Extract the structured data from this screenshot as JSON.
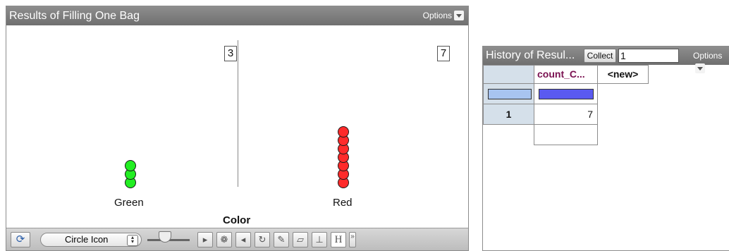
{
  "graph": {
    "title": "Results of Filling One Bag",
    "options_label": "Options",
    "axis_label": "Color",
    "categories": [
      {
        "name": "Green",
        "count": "3",
        "dot_color": "#22ee22"
      },
      {
        "name": "Red",
        "count": "7",
        "dot_color": "#ff2a2a"
      }
    ],
    "toolbar": {
      "select_value": "Circle Icon",
      "icons": [
        "rescale-icon",
        "point-size-slider-icon",
        "select-arrow-icon",
        "hide-show-icon",
        "move-left-icon",
        "add-rotate-icon",
        "pencil-icon",
        "eraser-icon",
        "plot-value-icon",
        "hide-axis-icon",
        "more-icon"
      ]
    }
  },
  "table": {
    "title": "History of Resul...",
    "collect_label": "Collect",
    "collect_value": "1",
    "options_label": "Options",
    "columns": [
      "count_C...",
      "<new>"
    ],
    "rows": [
      {
        "index": "1",
        "value": "7"
      }
    ],
    "colors": {
      "index_header_bg": "#d5e0ea",
      "count_header_text": "#7a1050",
      "swatch_light": "#a8c4f0",
      "swatch_dark": "#5a5af0"
    }
  }
}
